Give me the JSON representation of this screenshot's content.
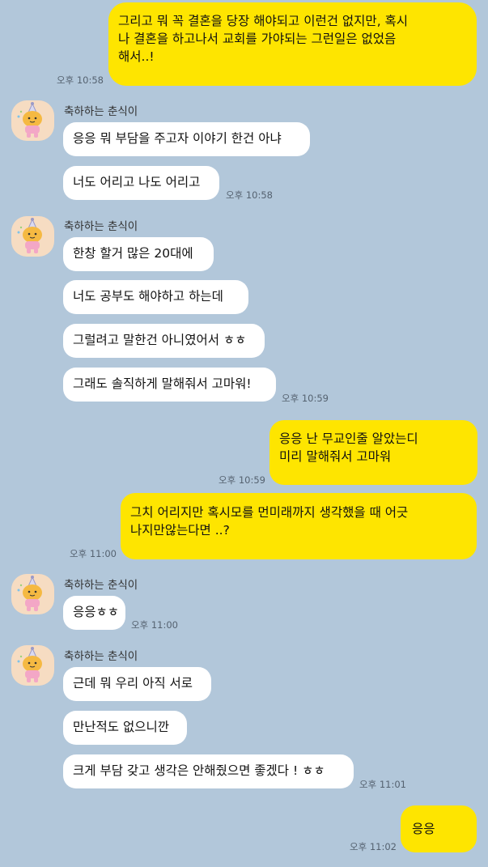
{
  "sender_name": "축하하는 춘식이",
  "messages": [
    {
      "text_lines": [
        "그리고 뭐 꼭 결혼을 당장 해야되고 이런건 없지만, 혹시",
        "나 결혼을 하고나서 교회를 가야되는 그런일은 없었음",
        "해서..!"
      ],
      "time": "오후 10:58"
    },
    {
      "text": "응응 뭐 부담을 주고자 이야기 한건 아냐"
    },
    {
      "text": "너도 어리고 나도 어리고",
      "time": "오후 10:58"
    },
    {
      "text": "한창 할거 많은 20대에"
    },
    {
      "text": "너도 공부도 해야하고 하는데"
    },
    {
      "text": "그럴려고 말한건 아니였어서 ㅎㅎ"
    },
    {
      "text": "그래도 솔직하게 말해줘서 고마워!",
      "time": "오후 10:59"
    },
    {
      "text_lines": [
        "응응 난 무교인줄 알았는디",
        "미리 말해줘서 고마워"
      ],
      "time": "오후 10:59"
    },
    {
      "text_lines": [
        "그치 어리지만 혹시모를 먼미래까지 생각했을 때 어긋",
        "나지만않는다면 ..?"
      ],
      "time": "오후 11:00"
    },
    {
      "text": "응응ㅎㅎ",
      "time": "오후 11:00"
    },
    {
      "text": "근데 뭐 우리 아직 서로"
    },
    {
      "text": "만난적도 없으니깐"
    },
    {
      "text": "크게 부담 갖고 생각은 안해줬으면 좋겠다 ! ㅎㅎ",
      "time": "오후 11:01"
    },
    {
      "text": "응응",
      "time": "오후 11:02"
    }
  ],
  "colors": {
    "background": "#b2c7da",
    "sent_bubble": "#fee500",
    "received_bubble": "#ffffff"
  },
  "avatar_icon": "chunsik-party-hat-icon"
}
